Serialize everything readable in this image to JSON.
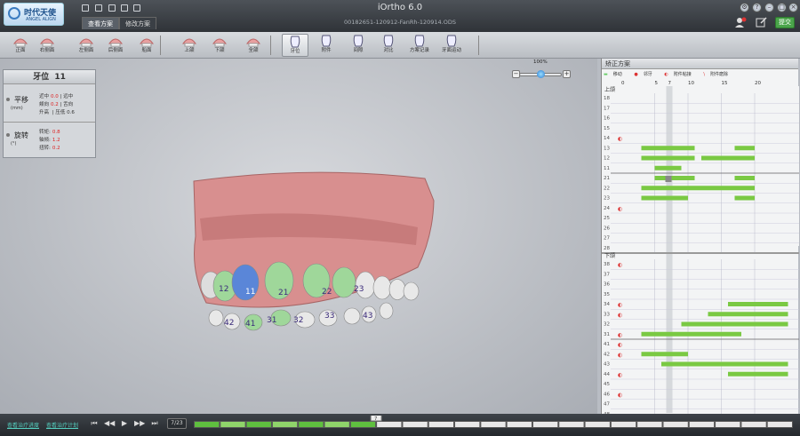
{
  "app": {
    "title": "iOrtho 6.0",
    "file": "00182651-120912-FanRh-120914.ODS",
    "logo_text": "时代天使",
    "logo_sub": "ANGEL ALIGN"
  },
  "tabs": [
    {
      "label": "查看方案"
    },
    {
      "label": "修改方案"
    }
  ],
  "submit_label": "提交",
  "toolbar": [
    {
      "label": "正面",
      "icon": "front-view-icon"
    },
    {
      "label": "右侧面",
      "icon": "right-view-icon"
    },
    {
      "label": "左侧面",
      "icon": "left-view-icon"
    },
    {
      "label": "后侧面",
      "icon": "back-view-icon"
    },
    {
      "label": "船面",
      "icon": "occlusal-view-icon"
    },
    {
      "label": "上颌",
      "icon": "upper-jaw-icon"
    },
    {
      "label": "下颌",
      "icon": "lower-jaw-icon"
    },
    {
      "label": "全颌",
      "icon": "full-jaw-icon"
    },
    {
      "label": "牙位",
      "icon": "tooth-position-icon"
    },
    {
      "label": "附件",
      "icon": "attachment-icon"
    },
    {
      "label": "间隙",
      "icon": "gap-icon"
    },
    {
      "label": "对比",
      "icon": "compare-icon"
    },
    {
      "label": "方案记录",
      "icon": "plan-record-icon"
    },
    {
      "label": "牙面运动",
      "icon": "surface-motion-icon"
    }
  ],
  "tooth_panel": {
    "title": "牙位",
    "tooth": "11",
    "translation": {
      "name": "平移",
      "unit": "(mm)",
      "rows": [
        {
          "l": "近中",
          "v": "0.0",
          "r": "| 远中"
        },
        {
          "l": "颊向",
          "v": "0.2",
          "r": "| 舌向"
        },
        {
          "l": "升高",
          "v": "",
          "r": "| 压低 0.6"
        }
      ]
    },
    "rotation": {
      "name": "旋转",
      "unit": "(°)",
      "rows": [
        {
          "l": "转矩:",
          "v": "0.8"
        },
        {
          "l": "轴倾:",
          "v": "1.2"
        },
        {
          "l": "扭转:",
          "v": "0.2"
        }
      ]
    }
  },
  "zoom": {
    "label": "100%",
    "level": 0.5
  },
  "tooth_labels": [
    "12",
    "11",
    "21",
    "22",
    "23",
    "31",
    "32",
    "33",
    "41",
    "42",
    "43"
  ],
  "plan": {
    "title": "矫正方案",
    "legend": [
      "移动",
      "邻牙",
      "附件粘接",
      "附件磨除"
    ],
    "axis": [
      "0",
      "5",
      "7",
      "10",
      "15",
      "20"
    ],
    "upper_label": "上颌",
    "lower_label": "下颌",
    "upper_rows": [
      "18",
      "17",
      "16",
      "15",
      "14",
      "13",
      "12",
      "11",
      "21",
      "22",
      "23",
      "24",
      "25",
      "26",
      "27",
      "28"
    ],
    "lower_rows": [
      "38",
      "37",
      "36",
      "35",
      "34",
      "33",
      "32",
      "31",
      "41",
      "42",
      "43",
      "44",
      "45",
      "46",
      "47",
      "48"
    ],
    "upper_bars": [
      [
        "13",
        3,
        11
      ],
      [
        "13",
        17,
        20
      ],
      [
        "12",
        3,
        11
      ],
      [
        "12",
        12,
        20
      ],
      [
        "11",
        5,
        9
      ],
      [
        "21",
        5,
        11
      ],
      [
        "21",
        17,
        20
      ],
      [
        "22",
        3,
        20
      ],
      [
        "23",
        3,
        10
      ],
      [
        "23",
        17,
        20
      ]
    ],
    "lower_bars": [
      [
        "34",
        16,
        25
      ],
      [
        "33",
        13,
        25
      ],
      [
        "32",
        9,
        25
      ],
      [
        "31",
        3,
        18
      ],
      [
        "42",
        3,
        10
      ],
      [
        "43",
        6,
        25
      ],
      [
        "44",
        16,
        25
      ]
    ],
    "upper_marks": [
      "14",
      "24"
    ],
    "lower_marks": [
      "38",
      "34",
      "33",
      "31",
      "41",
      "42",
      "44",
      "46"
    ],
    "current": 7
  },
  "playback": {
    "link1": "查看治疗进度",
    "link2": "查看治疗计划",
    "step": "7/23",
    "marker": "7",
    "progress": 0.3
  }
}
